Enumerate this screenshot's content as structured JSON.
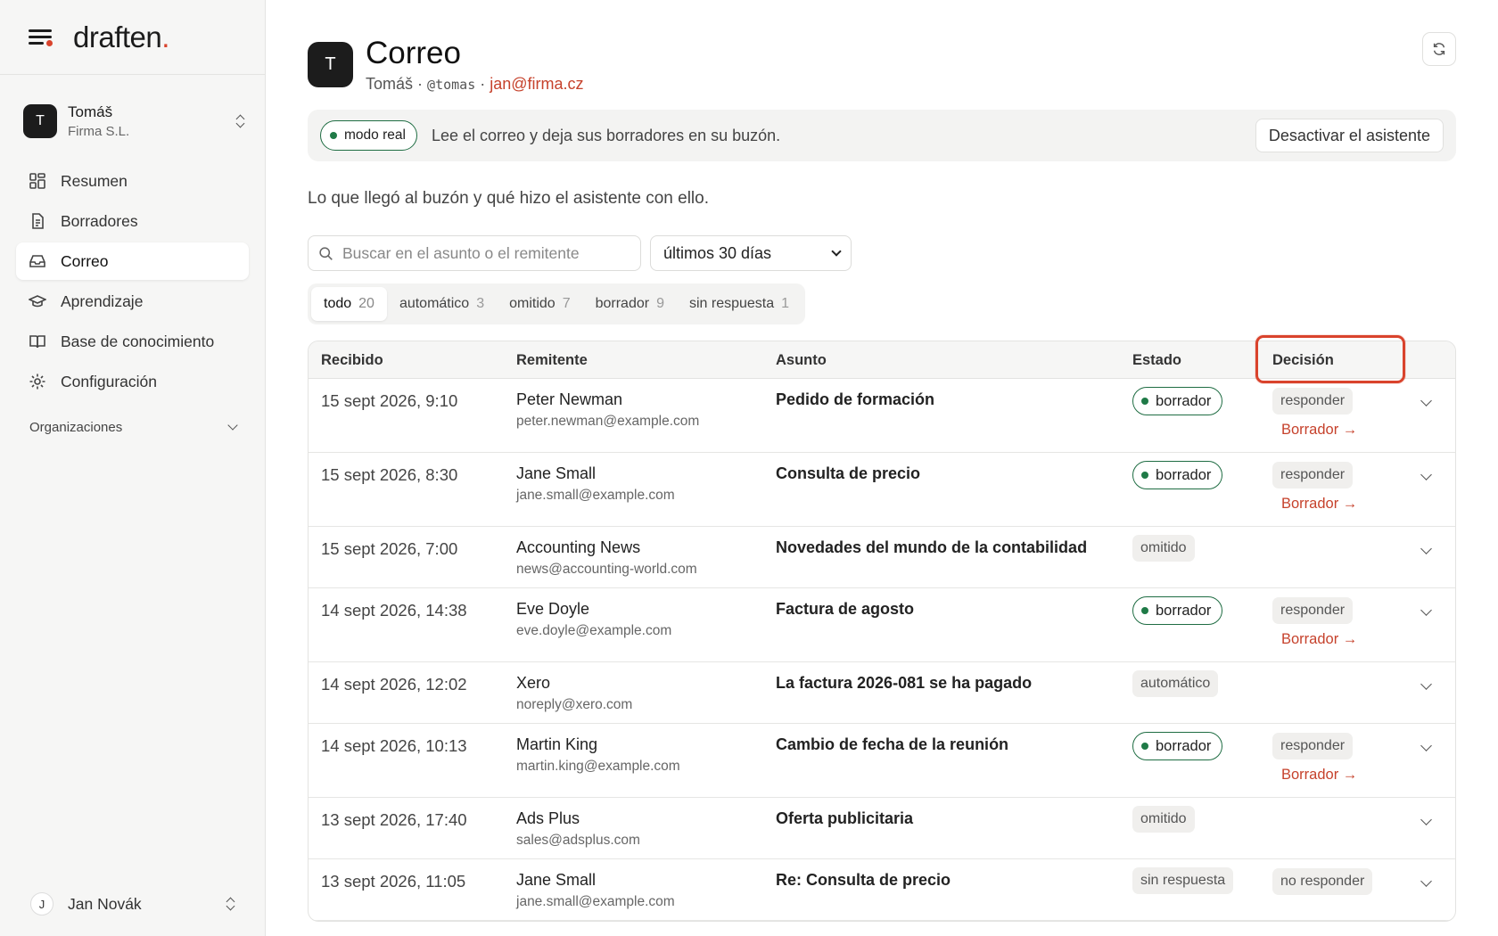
{
  "brand": {
    "logo": "draften",
    "logo_dot": "."
  },
  "org": {
    "avatar": "T",
    "name": "Tomáš",
    "company": "Firma S.L."
  },
  "nav": [
    {
      "label": "Resumen",
      "icon": "dashboard-icon"
    },
    {
      "label": "Borradores",
      "icon": "document-icon"
    },
    {
      "label": "Correo",
      "icon": "inbox-icon",
      "active": true
    },
    {
      "label": "Aprendizaje",
      "icon": "graduation-cap-icon"
    },
    {
      "label": "Base de conocimiento",
      "icon": "book-icon"
    },
    {
      "label": "Configuración",
      "icon": "gear-icon"
    }
  ],
  "organizations_label": "Organizaciones",
  "user": {
    "avatar": "J",
    "name": "Jan Novák"
  },
  "header": {
    "avatar": "T",
    "title": "Correo",
    "name": "Tomáš",
    "sep": "·",
    "handle": "@tomas",
    "email": "jan@firma.cz"
  },
  "banner": {
    "mode": "modo real",
    "message": "Lee el correo y deja sus borradores en su buzón.",
    "button": "Desactivar el asistente"
  },
  "intro": "Lo que llegó al buzón y qué hizo el asistente con ello.",
  "search": {
    "placeholder": "Buscar en el asunto o el remitente",
    "value": ""
  },
  "period": "últimos 30 días",
  "tabs": [
    {
      "label": "todo",
      "count": "20",
      "active": true
    },
    {
      "label": "automático",
      "count": "3"
    },
    {
      "label": "omitido",
      "count": "7"
    },
    {
      "label": "borrador",
      "count": "9"
    },
    {
      "label": "sin respuesta",
      "count": "1"
    }
  ],
  "columns": {
    "received": "Recibido",
    "sender": "Remitente",
    "subject": "Asunto",
    "status": "Estado",
    "decision": "Decisión"
  },
  "rows": [
    {
      "date": "15 sept 2026, 9:10",
      "name": "Peter Newman",
      "email": "peter.newman@example.com",
      "subject": "Pedido de formación",
      "status": "borrador",
      "decision": "responder",
      "link": "Borrador →"
    },
    {
      "date": "15 sept 2026, 8:30",
      "name": "Jane Small",
      "email": "jane.small@example.com",
      "subject": "Consulta de precio",
      "status": "borrador",
      "decision": "responder",
      "link": "Borrador →"
    },
    {
      "date": "15 sept 2026, 7:00",
      "name": "Accounting News",
      "email": "news@accounting-world.com",
      "subject": "Novedades del mundo de la contabilidad",
      "status": "omitido",
      "decision": "",
      "link": ""
    },
    {
      "date": "14 sept 2026, 14:38",
      "name": "Eve Doyle",
      "email": "eve.doyle@example.com",
      "subject": "Factura de agosto",
      "status": "borrador",
      "decision": "responder",
      "link": "Borrador →"
    },
    {
      "date": "14 sept 2026, 12:02",
      "name": "Xero",
      "email": "noreply@xero.com",
      "subject": "La factura 2026-081 se ha pagado",
      "status": "automático",
      "decision": "",
      "link": ""
    },
    {
      "date": "14 sept 2026, 10:13",
      "name": "Martin King",
      "email": "martin.king@example.com",
      "subject": "Cambio de fecha de la reunión",
      "status": "borrador",
      "decision": "responder",
      "link": "Borrador →"
    },
    {
      "date": "13 sept 2026, 17:40",
      "name": "Ads Plus",
      "email": "sales@adsplus.com",
      "subject": "Oferta publicitaria",
      "status": "omitido",
      "decision": "",
      "link": ""
    },
    {
      "date": "13 sept 2026, 11:05",
      "name": "Jane Small",
      "email": "jane.small@example.com",
      "subject": "Re: Consulta de precio",
      "status": "sin respuesta",
      "decision": "no responder",
      "link": ""
    }
  ]
}
